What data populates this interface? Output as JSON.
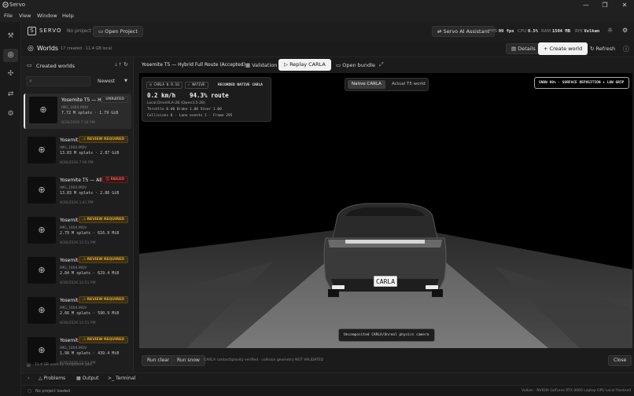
{
  "window": {
    "title": "Servo",
    "minimize": "—",
    "maximize": "❐",
    "close": "✕"
  },
  "menu": [
    "File",
    "View",
    "Window",
    "Help"
  ],
  "header": {
    "brand": "SERVO",
    "project": "No project",
    "open_project": "Open Project",
    "assistant": "Servo AI Assistant",
    "stats": {
      "fps_label": "FPS",
      "fps": "99 fps",
      "cpu_label": "CPU",
      "cpu": "0.5%",
      "ram_label": "RAM",
      "ram": "1504 MB",
      "rhi_label": "RHI",
      "rhi": "Vulkan"
    }
  },
  "subheader": {
    "title": "Worlds",
    "summary": "17 created · 11.4 GB local",
    "details": "Details",
    "create_world": "Create world",
    "refresh": "Refresh"
  },
  "sidebar": {
    "title": "Created worlds",
    "sort": "Newest",
    "storage": "11.4 GB used by completed jobs",
    "worlds": [
      {
        "name": "Yosemite T5 — Hy...",
        "file": "IMG_1004.MOV",
        "meta": "7.72 M splats · 1.79 GiB",
        "date": "8/26/2026 7:34 PM",
        "status": "UNRATED",
        "kind": "unrated"
      },
      {
        "name": "Yosemit...",
        "file": "IMG_1004.MOV",
        "meta": "13.83 M splats · 2.87 GiB",
        "date": "8/26/2026 7:06 PM",
        "status": "REVIEW REQUIRED",
        "kind": "review"
      },
      {
        "name": "Yosemite T5 — All...",
        "file": "IMG_1004.MOV",
        "meta": "13.83 M splats · 2.86 GiB",
        "date": "8/26/2026 1:41 PM",
        "status": "FAILED",
        "kind": "failed"
      },
      {
        "name": "Yosemit...",
        "file": "IMG_1004.MOV",
        "meta": "2.79 M splats · 616.9 MiB",
        "date": "8/26/2026 12:51 PM",
        "status": "REVIEW REQUIRED",
        "kind": "review"
      },
      {
        "name": "Yosemit...",
        "file": "IMG_1004.MOV",
        "meta": "2.84 M splats · 629.4 MiB",
        "date": "8/26/2026 12:51 PM",
        "status": "REVIEW REQUIRED",
        "kind": "review"
      },
      {
        "name": "Yosemit...",
        "file": "IMG_1004.MOV",
        "meta": "2.66 M splats · 590.9 MiB",
        "date": "8/26/2026 12:51 PM",
        "status": "REVIEW REQUIRED",
        "kind": "review"
      },
      {
        "name": "Yosemit...",
        "file": "IMG_1004.MOV",
        "meta": "1.98 M splats · 439.4 MiB",
        "date": "8/26/2026 12:51 PM",
        "status": "REVIEW REQUIRED",
        "kind": "review"
      }
    ]
  },
  "tabs": {
    "world_title": "Yosemite T5 — Hybrid Full Route (Accepted)",
    "validation": "Validation",
    "replay": "Replay CARLA",
    "open_bundle": "Open bundle"
  },
  "viewport": {
    "badge_version": "CARLA 0.9.16",
    "badge_native": "NATIVE",
    "recorded": "RECORDED NATIVE CARLA",
    "speed": "0.2 km/h",
    "route": "94.3% route",
    "model": "Local DriveVLA-2B (Qwen3.5-2B)",
    "controls": "Throttle 0.00   Brake 1.00   Steer 1.00",
    "collisions": "Collisions 0   ·   Lane events 1   ·   Frame 295",
    "toggle_native": "Native CARLA",
    "toggle_t5": "Actual T5 world",
    "weather": "SNOW 90% · SURFACE DEPOSITION + LOW GRIP",
    "plate": "CARLA",
    "camera_note": "Uncomposited CARLA/Unreal physics camera"
  },
  "vbar": {
    "run_clear": "Run clear",
    "run_snow": "Run snow",
    "note": "CARLA contact/gravity verified · collision geometry NOT VALIDATED",
    "close": "Close"
  },
  "bottom_tabs": {
    "problems": "Problems",
    "output": "Output",
    "terminal": "Terminal"
  },
  "status": {
    "left": "No project loaded",
    "gpu": "Vulkan · NVIDIA GeForce RTX 4060 Laptop GPU",
    "frontend": "Local frontend"
  },
  "colors": {
    "accent": "#ffffff",
    "review": "#e0a93a",
    "failed": "#e06060",
    "background": "#1b1b1b"
  }
}
